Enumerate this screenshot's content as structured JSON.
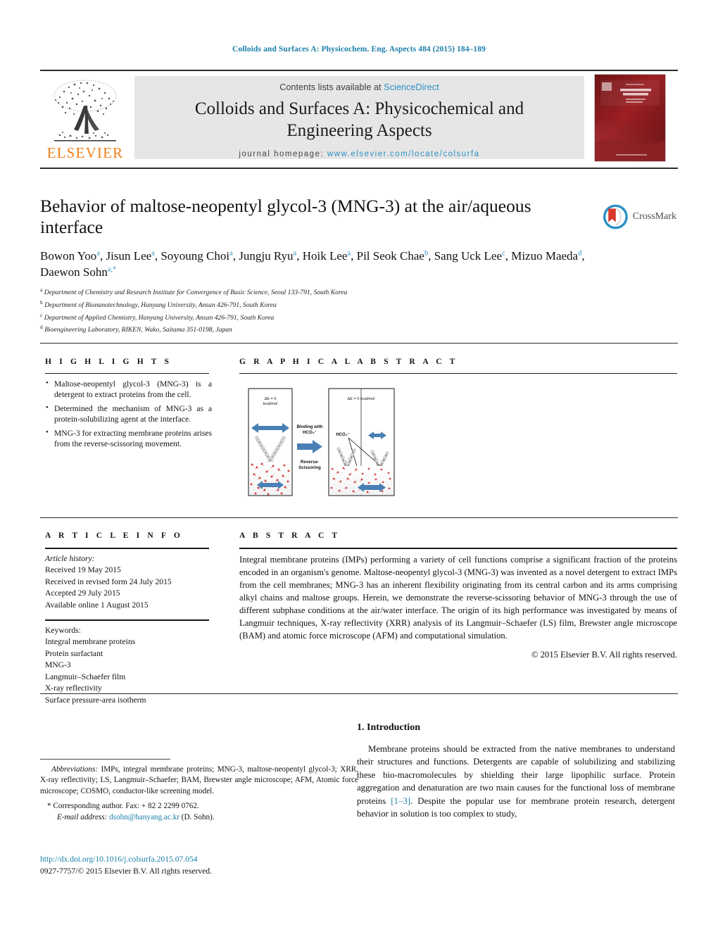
{
  "running_head": "Colloids and Surfaces A: Physicochem. Eng. Aspects 484 (2015) 184–189",
  "masthead": {
    "publisher": "ELSEVIER",
    "contents_prefix": "Contents lists available at ",
    "contents_link": "ScienceDirect",
    "journal_title_line1": "Colloids and Surfaces A: Physicochemical and",
    "journal_title_line2": "Engineering Aspects",
    "homepage_prefix": "journal homepage: ",
    "homepage_url": "www.elsevier.com/locate/colsurfa",
    "cover_alt": "journal-cover-thumbnail"
  },
  "article": {
    "title": "Behavior of maltose-neopentyl glycol-3 (MNG-3) at the air/aqueous interface",
    "crossmark_label": "CrossMark",
    "authors": [
      {
        "name": "Bowon Yoo",
        "sup": "a"
      },
      {
        "name": "Jisun Lee",
        "sup": "a"
      },
      {
        "name": "Soyoung Choi",
        "sup": "a"
      },
      {
        "name": "Jungju Ryu",
        "sup": "a"
      },
      {
        "name": "Hoik Lee",
        "sup": "a"
      },
      {
        "name": "Pil Seok Chae",
        "sup": "b"
      },
      {
        "name": "Sang Uck Lee",
        "sup": "c"
      },
      {
        "name": "Mizuo Maeda",
        "sup": "d"
      },
      {
        "name": "Daewon Sohn",
        "sup": "a,*"
      }
    ],
    "affiliations": [
      {
        "mark": "a",
        "text": "Department of Chemistry and Research Institute for Convergence of Basic Science, Seoul 133-791, South Korea"
      },
      {
        "mark": "b",
        "text": "Department of Bionanotechnology, Hanyang University, Ansan 426-791, South Korea"
      },
      {
        "mark": "c",
        "text": "Department of Applied Chemistry, Hanyang University, Ansan 426-791, South Korea"
      },
      {
        "mark": "d",
        "text": "Bioengineering Laboratory, RIKEN, Wako, Saitama 351-0198, Japan"
      }
    ]
  },
  "highlights": {
    "heading": "H I G H L I G H T S",
    "items": [
      "Maltose-neopentyl glycol-3 (MNG-3) is a detergent to extract proteins from the cell.",
      "Determined the mechanism of MNG-3 as a protein-solubilizing agent at the interface.",
      "MNG-3 for extracting membrane proteins arises from the reverse-scissoring movement."
    ]
  },
  "graphical_abstract": {
    "heading": "G R A P H I C A L   A B S T R A C T",
    "panel_left": {
      "energy_line1": "ΔE = 0",
      "energy_line2": "kcal/mol"
    },
    "panel_right": {
      "energy": "ΔE = 0 kcal/mol",
      "species": "HCO₃⁻"
    },
    "arrow_labels": {
      "top_line1": "Binding with",
      "top_line2": "HCO₃⁻",
      "bottom_line1": "Reverse-",
      "bottom_line2": "Scissoring"
    }
  },
  "article_info": {
    "heading": "A R T I C L E   I N F O",
    "history_label": "Article history:",
    "history": [
      "Received 19 May 2015",
      "Received in revised form 24 July 2015",
      "Accepted 29 July 2015",
      "Available online 1 August 2015"
    ],
    "keywords_label": "Keywords:",
    "keywords": [
      "Integral membrane proteins",
      "Protein surfactant",
      "MNG-3",
      "Langmuir–Schaefer film",
      "X-ray reflectivity",
      "Surface pressure-area isotherm"
    ]
  },
  "abstract": {
    "heading": "A B S T R A C T",
    "text": "Integral membrane proteins (IMPs) performing a variety of cell functions comprise a significant fraction of the proteins encoded in an organism's genome. Maltose-neopentyl glycol-3 (MNG-3) was invented as a novel detergent to extract IMPs from the cell membranes; MNG-3 has an inherent flexibility originating from its central carbon and its arms comprising alkyl chains and maltose groups. Herein, we demonstrate the reverse-scissoring behavior of MNG-3 through the use of different subphase conditions at the air/water interface. The origin of its high performance was investigated by means of Langmuir techniques, X-ray reflectivity (XRR) analysis of its Langmuir–Schaefer (LS) film, Brewster angle microscope (BAM) and atomic force microscope (AFM) and computational simulation.",
    "copyright": "© 2015 Elsevier B.V. All rights reserved."
  },
  "introduction": {
    "heading": "1.  Introduction",
    "paragraph_part1": "Membrane proteins should be extracted from the native membranes to understand their structures and functions. Detergents are capable of solubilizing and stabilizing these bio-macromolecules by shielding their large lipophilic surface. Protein aggregation and denaturation are two main causes for the functional loss of membrane proteins ",
    "citation": "[1–3]",
    "paragraph_part2": ". Despite the popular use for membrane protein research, detergent behavior in solution is too complex to study,"
  },
  "footnotes": {
    "abbrev_label": "Abbreviations:",
    "abbrev_text": " IMPs, integral membrane proteins; MNG-3, maltose-neopentyl glycol-3; XRR, X-ray reflectivity; LS, Langmuir–Schaefer; BAM, Brewster angle microscope; AFM, Atomic force microscope; COSMO, conductor-like screening model.",
    "corresponding_marker": "*",
    "corresponding_text": "Corresponding author. Fax: + 82 2 2299 0762.",
    "email_label": "E-mail address:",
    "email": "dsohn@hanyang.ac.kr",
    "email_suffix": " (D. Sohn)."
  },
  "footer": {
    "doi": "http://dx.doi.org/10.1016/j.colsurfa.2015.07.054",
    "issn_line": "0927-7757/© 2015 Elsevier B.V. All rights reserved."
  },
  "colors": {
    "link_blue": "#1b7fa8",
    "sd_blue": "#2b8fc4",
    "elsevier_orange": "#F07F1A",
    "banner_gray": "#e6e6e6",
    "cover_red": "#8e1d20"
  }
}
